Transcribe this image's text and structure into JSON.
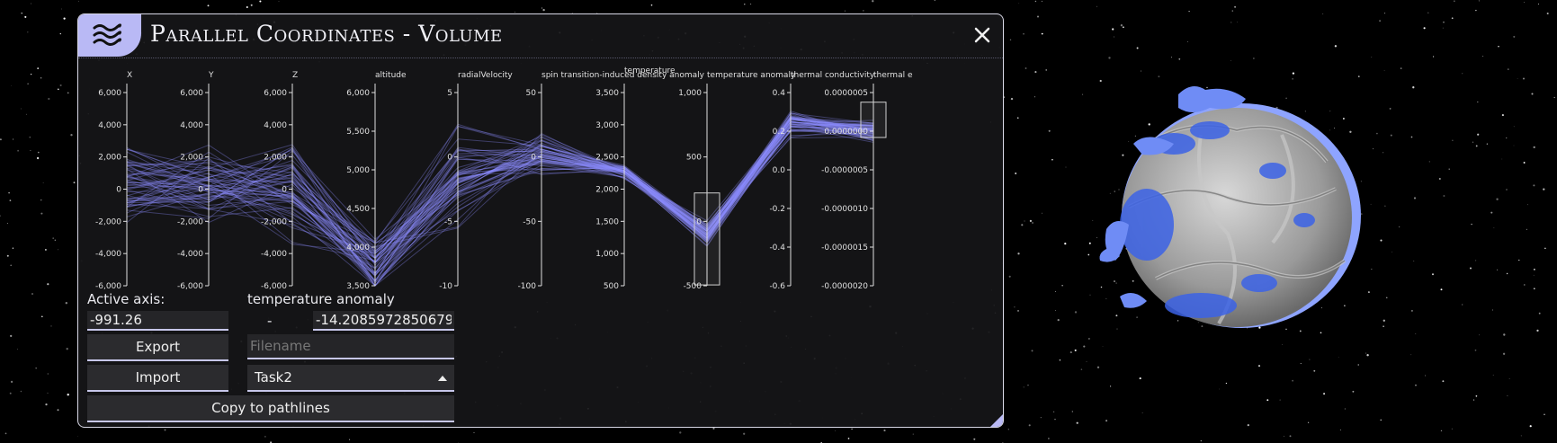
{
  "window": {
    "title": "Parallel Coordinates - Volume",
    "menu_icon": "waves-icon",
    "close_icon": "close-icon"
  },
  "controls": {
    "active_axis_label": "Active axis:",
    "active_axis_name": "temperature anomaly",
    "range_min": "-991.26",
    "range_separator": "-",
    "range_max": "-14.2085972850679",
    "export_label": "Export",
    "import_label": "Import",
    "filename_placeholder": "Filename",
    "preset_selected": "Task2",
    "copy_label": "Copy to pathlines"
  },
  "colors": {
    "accent": "#b9b9f5",
    "lines": "#8c8cff",
    "panel": "#161618"
  },
  "chart_data": {
    "type": "parallel_coordinates",
    "axes": [
      {
        "name": "X",
        "range": [
          -6000,
          6000
        ],
        "ticks": [
          "6,000",
          "4,000",
          "2,000",
          "0",
          "-2,000",
          "-4,000",
          "-6,000"
        ]
      },
      {
        "name": "Y",
        "range": [
          -6000,
          6000
        ],
        "ticks": [
          "6,000",
          "4,000",
          "2,000",
          "0",
          "-2,000",
          "-4,000",
          "-6,000"
        ]
      },
      {
        "name": "Z",
        "range": [
          -6000,
          6000
        ],
        "ticks": [
          "6,000",
          "4,000",
          "2,000",
          "0",
          "-2,000",
          "-4,000",
          "-6,000"
        ]
      },
      {
        "name": "altitude",
        "range": [
          3500,
          6500
        ],
        "ticks": [
          "6,000",
          "5,500",
          "5,000",
          "4,500",
          "4,000",
          "3,500"
        ]
      },
      {
        "name": "radialVelocity",
        "range": [
          -10,
          8
        ],
        "ticks": [
          "5",
          "0",
          "-5",
          "-10"
        ]
      },
      {
        "name": "spin transition-induced density anomaly",
        "range": [
          -120,
          80
        ],
        "ticks": [
          "50",
          "0",
          "-50",
          "-100"
        ]
      },
      {
        "name": "temperature",
        "range": [
          400,
          3700
        ],
        "ticks": [
          "3,500",
          "3,000",
          "2,500",
          "2,000",
          "1,500",
          "1,000",
          "500"
        ]
      },
      {
        "name": "temperature anomaly",
        "range": [
          -1000,
          1100
        ],
        "ticks": [
          "1,000",
          "500",
          "0",
          "-500"
        ],
        "brush": [
          -991.26,
          -14.2085972850679
        ]
      },
      {
        "name": "thermal conductivity",
        "range": [
          -0.75,
          0.5
        ],
        "ticks": [
          "0.4",
          "0.2",
          "0.0",
          "-0.2",
          "-0.4",
          "-0.6"
        ]
      },
      {
        "name": "thermal e",
        "range": [
          -2.1e-06,
          7e-07
        ],
        "ticks": [
          "0.0000005",
          "0.0000000",
          "-0.0000005",
          "-0.0000010",
          "-0.0000015",
          "-0.0000020"
        ],
        "brush": [
          0,
          5e-07
        ]
      }
    ],
    "line_count": 60,
    "centers": [
      0,
      0,
      0,
      3800,
      0,
      10,
      2300,
      -450,
      0.28,
      1e-07
    ],
    "spreads": [
      3600,
      3600,
      4000,
      600,
      7,
      30,
      150,
      150,
      0.12,
      2e-07
    ]
  }
}
